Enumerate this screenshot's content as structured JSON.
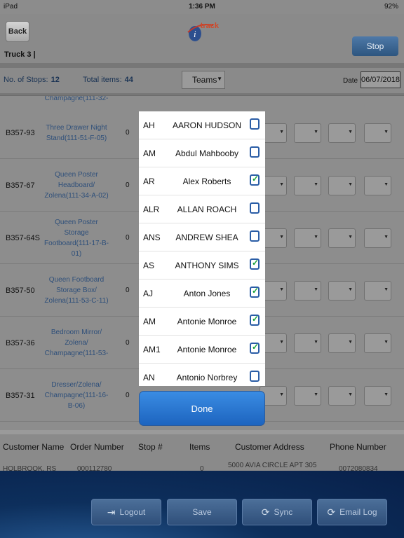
{
  "statusbar": {
    "device": "iPad",
    "time": "1:36 PM",
    "battery": "92%"
  },
  "nav": {
    "back_label": "Back",
    "truck_label": "Truck 3 |",
    "stop_label": "Stop",
    "logo_text": "-track"
  },
  "info": {
    "stops_label": "No. of Stops:",
    "stops_value": "12",
    "items_label": "Total items:",
    "items_value": "44",
    "teams_label": "Teams",
    "date_label": "Date :",
    "date_value": "06/07/2018"
  },
  "table": {
    "partial_top": "Champagne(111-32-",
    "rows": [
      {
        "code": "B357-93",
        "desc": "Three Drawer Night Stand(111-51-F-05)",
        "qty": "0"
      },
      {
        "code": "B357-67",
        "desc": "Queen Poster Headboard/ Zolena(111-34-A-02)",
        "qty": "0"
      },
      {
        "code": "B357-64S",
        "desc": "Queen Poster Storage Footboard(111-17-B-01)",
        "qty": "0"
      },
      {
        "code": "B357-50",
        "desc": "Queen Footboard Storage Box/ Zolena(111-53-C-11)",
        "qty": "0"
      },
      {
        "code": "B357-36",
        "desc": "Bedroom Mirror/ Zolena/ Champagne(111-53-",
        "qty": "0"
      },
      {
        "code": "B357-31",
        "desc": "Dresser/Zolena/ Champagne(111-16-B-06)",
        "qty": "0"
      }
    ]
  },
  "modal": {
    "people": [
      {
        "initials": "AH",
        "name": "AARON HUDSON",
        "checked": false
      },
      {
        "initials": "AM",
        "name": "Abdul Mahbooby",
        "checked": false
      },
      {
        "initials": "AR",
        "name": "Alex Roberts",
        "checked": true
      },
      {
        "initials": "ALR",
        "name": "ALLAN ROACH",
        "checked": false
      },
      {
        "initials": "ANS",
        "name": "ANDREW SHEA",
        "checked": false
      },
      {
        "initials": "AS",
        "name": "ANTHONY SIMS",
        "checked": true
      },
      {
        "initials": "AJ",
        "name": "Anton Jones",
        "checked": true
      },
      {
        "initials": "AM",
        "name": "Antonie Monroe",
        "checked": true
      },
      {
        "initials": "AM1",
        "name": "Antonie Monroe",
        "checked": true
      },
      {
        "initials": "AN",
        "name": "Antonio Norbrey",
        "checked": false
      }
    ],
    "done_label": "Done"
  },
  "customer": {
    "headers": [
      "Customer Name",
      "Order Number",
      "Stop #",
      "Items",
      "Customer Address",
      "Phone Number"
    ],
    "partial_row": [
      "HOLBROOK, RS",
      "000112780",
      "",
      "0",
      "5000 AVIA CIRCLE APT 305",
      "0072080834"
    ]
  },
  "footer": {
    "logout": "Logout",
    "save": "Save",
    "sync": "Sync",
    "email_log": "Email Log"
  },
  "colors": {
    "check": "#18a23a",
    "checkbox_border": "#2a5da6",
    "accent": "#1d64bf"
  }
}
